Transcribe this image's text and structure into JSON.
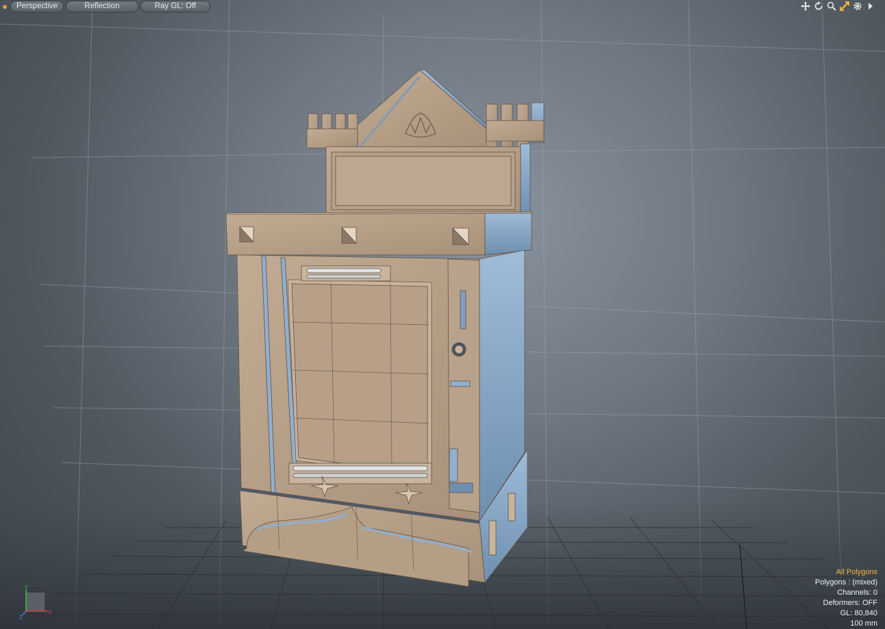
{
  "toolbar": {
    "view_mode": "Perspective",
    "shading": "Reflection",
    "ray_gl": "Ray GL: Off",
    "icons": [
      "move-view-icon",
      "rotate-view-icon",
      "zoom-view-icon",
      "fit-view-icon",
      "settings-gear-icon",
      "more-arrow-icon"
    ]
  },
  "info": {
    "selection_mode": "All Polygons",
    "polygons": "Polygons : (mixed)",
    "channels": "Channels: 0",
    "deformers": "Deformers: OFF",
    "gl": "GL: 80,840",
    "grid_size": "100 mm"
  },
  "axis": {
    "y": "Y",
    "x": "X",
    "z": "Z"
  },
  "colors": {
    "accent_orange": "#f2b33d",
    "model_front": "#b59e86",
    "model_side": "#7ea0c0"
  }
}
